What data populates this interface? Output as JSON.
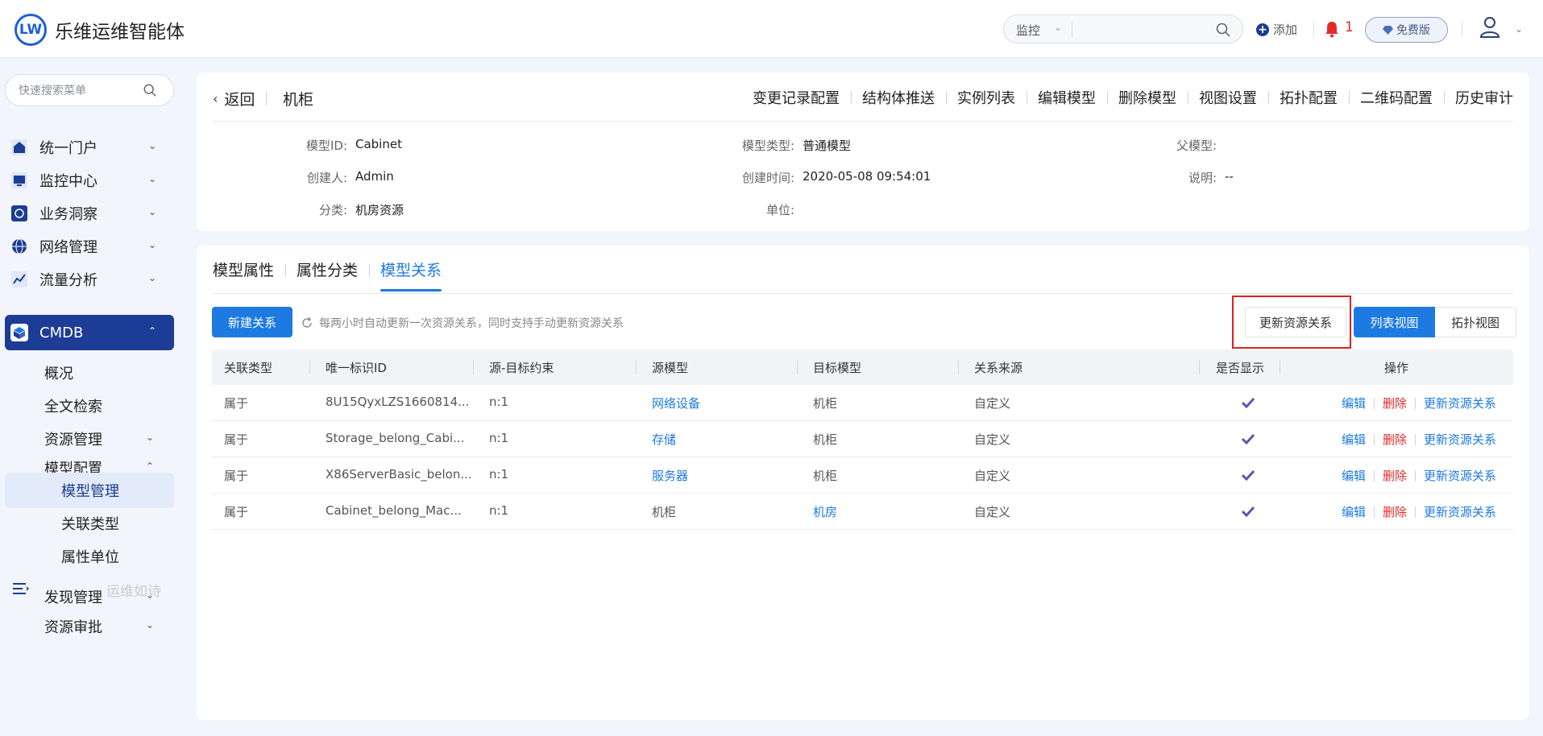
{
  "header": {
    "logo_text": "LW",
    "title": "乐维运维智能体",
    "search_select": "监控",
    "add_label": "添加",
    "bell_count": "1",
    "free_label": "免费版"
  },
  "sidebar": {
    "search_placeholder": "快速搜索菜单",
    "items": [
      {
        "label": "统一门户"
      },
      {
        "label": "监控中心"
      },
      {
        "label": "业务洞察"
      },
      {
        "label": "网络管理"
      },
      {
        "label": "流量分析"
      },
      {
        "label": "CMDB"
      }
    ],
    "cmdb_sub": {
      "overview": "概况",
      "fulltext": "全文检索",
      "resource_mgmt": "资源管理",
      "model_config": "模型配置",
      "model_mgmt": "模型管理",
      "relation_type": "关联类型",
      "attr_unit": "属性单位",
      "discovery": "发现管理",
      "resource_approval": "资源审批"
    },
    "slogan": "运维如诗"
  },
  "info": {
    "back_label": "返回",
    "model_name": "机柜",
    "actions": [
      "变更记录配置",
      "结构体推送",
      "实例列表",
      "编辑模型",
      "删除模型",
      "视图设置",
      "拓扑配置",
      "二维码配置",
      "历史审计"
    ],
    "fields": {
      "model_id_k": "模型ID:",
      "model_id_v": "Cabinet",
      "creator_k": "创建人:",
      "creator_v": "Admin",
      "category_k": "分类:",
      "category_v": "机房资源",
      "model_type_k": "模型类型:",
      "model_type_v": "普通模型",
      "created_time_k": "创建时间:",
      "created_time_v": "2020-05-08 09:54:01",
      "unit_k": "单位:",
      "unit_v": "",
      "parent_k": "父模型:",
      "parent_v": "",
      "desc_k": "说明:",
      "desc_v": "--"
    }
  },
  "main": {
    "tabs": [
      "模型属性",
      "属性分类",
      "模型关系"
    ],
    "new_btn": "新建关系",
    "auto_note": "每两小时自动更新一次资源关系，同时支持手动更新资源关系",
    "update_btn": "更新资源关系",
    "view_list": "列表视图",
    "view_topo": "拓扑视图",
    "columns": [
      "关联类型",
      "唯一标识ID",
      "源-目标约束",
      "源模型",
      "目标模型",
      "关系来源",
      "是否显示",
      "操作"
    ],
    "rows": [
      {
        "type": "属于",
        "uid": "8U15QyxLZS1660814...",
        "constraint": "n:1",
        "src": "网络设备",
        "dst": "机柜",
        "origin": "自定义"
      },
      {
        "type": "属于",
        "uid": "Storage_belong_Cabi...",
        "constraint": "n:1",
        "src": "存储",
        "dst": "机柜",
        "origin": "自定义"
      },
      {
        "type": "属于",
        "uid": "X86ServerBasic_belon...",
        "constraint": "n:1",
        "src": "服务器",
        "dst": "机柜",
        "origin": "自定义"
      },
      {
        "type": "属于",
        "uid": "Cabinet_belong_Mac...",
        "constraint": "n:1",
        "src": "机柜",
        "dst": "机房",
        "origin": "自定义"
      }
    ],
    "op_edit": "编辑",
    "op_delete": "删除",
    "op_update": "更新资源关系"
  },
  "colors": {
    "primary": "#1d7ae0",
    "sidebar_active": "#1d3c95",
    "danger": "#e02b2b",
    "check": "#6a4fb0"
  }
}
